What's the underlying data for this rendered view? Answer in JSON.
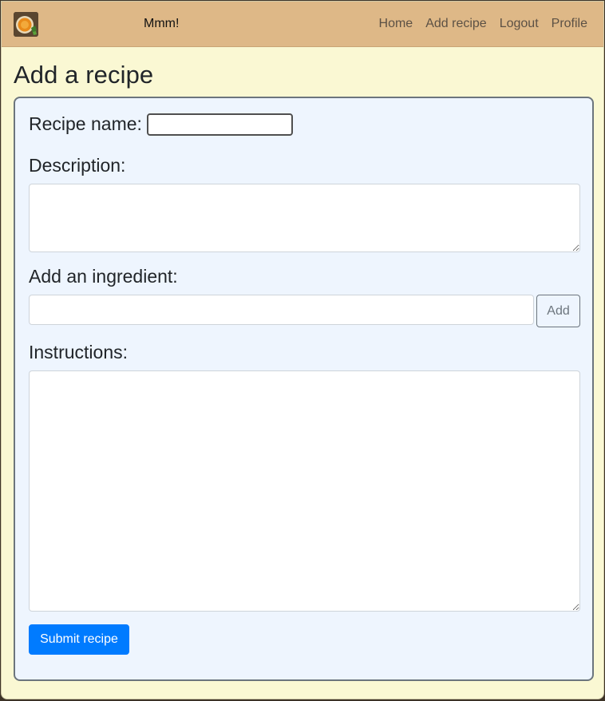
{
  "navbar": {
    "brand": "Mmm!",
    "logo_icon": "soup-bowl-icon",
    "background": "#deb887",
    "links": [
      {
        "label": "Home"
      },
      {
        "label": "Add recipe"
      },
      {
        "label": "Logout"
      },
      {
        "label": "Profile"
      }
    ]
  },
  "page": {
    "title": "Add a recipe",
    "background": "#faf8d3"
  },
  "form": {
    "background": "#eef5fe",
    "recipe_name": {
      "label": "Recipe name:",
      "value": "",
      "placeholder": ""
    },
    "description": {
      "label": "Description:",
      "value": "",
      "placeholder": ""
    },
    "ingredient": {
      "label": "Add an ingredient:",
      "value": "",
      "placeholder": "",
      "add_label": "Add"
    },
    "instructions": {
      "label": "Instructions:",
      "value": "",
      "placeholder": ""
    },
    "submit_label": "Submit recipe",
    "accent": "#007bff"
  }
}
